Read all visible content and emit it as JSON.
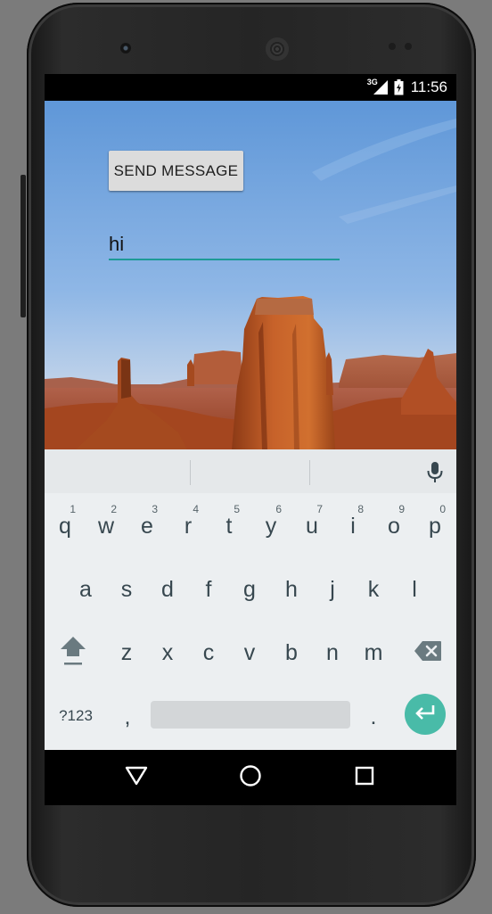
{
  "status_bar": {
    "network_type": "3G",
    "time": "11:56",
    "signal_icon": "signal-icon",
    "battery_icon": "battery-icon"
  },
  "app": {
    "send_button_label": "SEND MESSAGE",
    "message_value": "hi",
    "wallpaper": "desert-mesa-landscape",
    "accent_color": "#1d9a96"
  },
  "keyboard": {
    "row1": [
      {
        "label": "q",
        "hint": "1"
      },
      {
        "label": "w",
        "hint": "2"
      },
      {
        "label": "e",
        "hint": "3"
      },
      {
        "label": "r",
        "hint": "4"
      },
      {
        "label": "t",
        "hint": "5"
      },
      {
        "label": "y",
        "hint": "6"
      },
      {
        "label": "u",
        "hint": "7"
      },
      {
        "label": "i",
        "hint": "8"
      },
      {
        "label": "o",
        "hint": "9"
      },
      {
        "label": "p",
        "hint": "0"
      }
    ],
    "row2": [
      "a",
      "s",
      "d",
      "f",
      "g",
      "h",
      "j",
      "k",
      "l"
    ],
    "row3": [
      "z",
      "x",
      "c",
      "v",
      "b",
      "n",
      "m"
    ],
    "symbols_label": "?123",
    "comma": ",",
    "period": ".",
    "icons": [
      "mic-icon",
      "shift-icon",
      "backspace-icon",
      "enter-icon"
    ],
    "enter_color": "#49bba8"
  },
  "nav_bar": {
    "icons": [
      "back-icon",
      "home-icon",
      "recents-icon"
    ]
  }
}
